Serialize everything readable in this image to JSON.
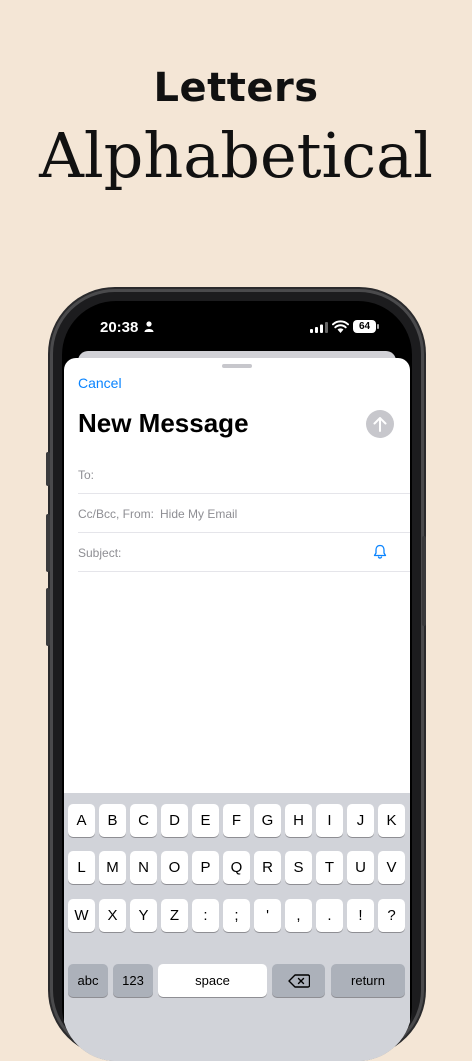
{
  "promo": {
    "headline": "Letters",
    "subline": "Alphabetical"
  },
  "status_bar": {
    "time": "20:38",
    "battery": "64"
  },
  "compose": {
    "cancel_label": "Cancel",
    "title": "New Message",
    "to_label": "To:",
    "ccbcc_label": "Cc/Bcc, From:",
    "from_value": "Hide My Email",
    "subject_label": "Subject:"
  },
  "keyboard": {
    "row1": [
      "A",
      "B",
      "C",
      "D",
      "E",
      "F",
      "G",
      "H",
      "I",
      "J",
      "K"
    ],
    "row2": [
      "L",
      "M",
      "N",
      "O",
      "P",
      "Q",
      "R",
      "S",
      "T",
      "U",
      "V"
    ],
    "row3": [
      "W",
      "X",
      "Y",
      "Z",
      ":",
      ";",
      "'",
      ",",
      ".",
      "!",
      "?"
    ],
    "abc_label": "abc",
    "num_label": "123",
    "space_label": "space",
    "return_label": "return"
  },
  "colors": {
    "accent": "#0a84ff",
    "background": "#f4e6d6",
    "keyboard_bg": "#d1d3d9"
  }
}
